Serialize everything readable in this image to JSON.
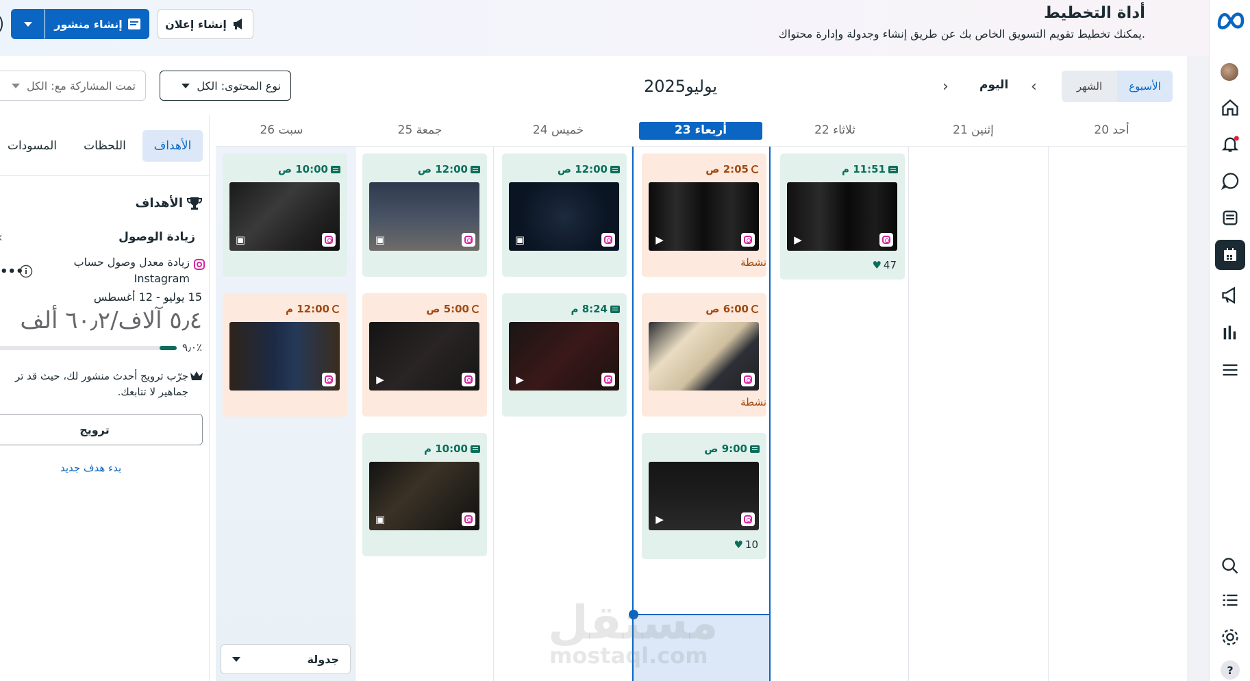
{
  "header": {
    "title": "أداة التخطيط",
    "subtitle": "يمكنك تخطيط تقويم التسويق الخاص بك عن طريق إنشاء وجدولة وإدارة محتواك.",
    "create_ad_label": "إنشاء إعلان",
    "create_post_label": "إنشاء منشور"
  },
  "toolbar": {
    "view_week": "الأسبوع",
    "view_month": "الشهر",
    "today_label": "اليوم",
    "month_title": "يوليو2025",
    "content_type_label": "نوع المحتوى: الكل",
    "shared_with_label": "تمت المشاركة مع: الكل"
  },
  "days": [
    {
      "label": "أحد 20",
      "today": false
    },
    {
      "label": "إثنين 21",
      "today": false
    },
    {
      "label": "ثلاثاء 22",
      "today": false
    },
    {
      "label": "أربعاء 23",
      "today": true
    },
    {
      "label": "خميس 24",
      "today": false
    },
    {
      "label": "جمعة 25",
      "today": false
    },
    {
      "label": "سبت 26",
      "today": false
    }
  ],
  "posts": {
    "tue_1": {
      "time": "11:51 م",
      "likes": "47"
    },
    "wed_1": {
      "time": "2:05 ص",
      "status": "نشطة"
    },
    "wed_2": {
      "time": "6:00 ص",
      "status": "نشطة"
    },
    "wed_3": {
      "time": "9:00 ص",
      "likes": "10"
    },
    "thu_1": {
      "time": "12:00 ص"
    },
    "thu_2": {
      "time": "8:24 م"
    },
    "fri_1": {
      "time": "12:00 ص"
    },
    "fri_2": {
      "time": "5:00 ص"
    },
    "fri_3": {
      "time": "10:00 م"
    },
    "sat_1": {
      "time": "10:00 ص"
    },
    "sat_2": {
      "time": "12:00 م"
    }
  },
  "schedule_dropdown_label": "جدولة",
  "left_panel": {
    "tabs": [
      "الأهداف",
      "اللحظات",
      "المسودات"
    ],
    "section_title": "الأهداف",
    "goal_title": "زيادة الوصول",
    "goal_desc_1": "زيادة معدل وصول حساب",
    "goal_desc_2": "Instagram",
    "goal_dates": "15 يوليو - 12 أغسطس",
    "goal_progress_text": "٥٫٤ آلاف/٦٠٫٢ ألف",
    "goal_percent": "٪٩٫٠",
    "goal_progress_fraction": 0.09,
    "promo_line_1": "جرّب ترويج أحدث منشور لك، حيث قد تر",
    "promo_line_2": "جماهير لا تتابعك.",
    "promote_button": "ترويج",
    "new_goal_link": "بدء هدف جديد"
  },
  "watermark": {
    "arabic": "مستقل",
    "latin": "mostaql.com"
  },
  "icons": [
    "meta-logo",
    "home-icon",
    "bell-icon",
    "chat-icon",
    "pages-icon",
    "calendar-icon",
    "megaphone-icon",
    "insights-icon",
    "menu-icon",
    "search-icon",
    "list-icon",
    "settings-icon",
    "help-icon",
    "instagram-icon",
    "trophy-icon",
    "info-icon",
    "crown-icon",
    "heart-icon"
  ]
}
